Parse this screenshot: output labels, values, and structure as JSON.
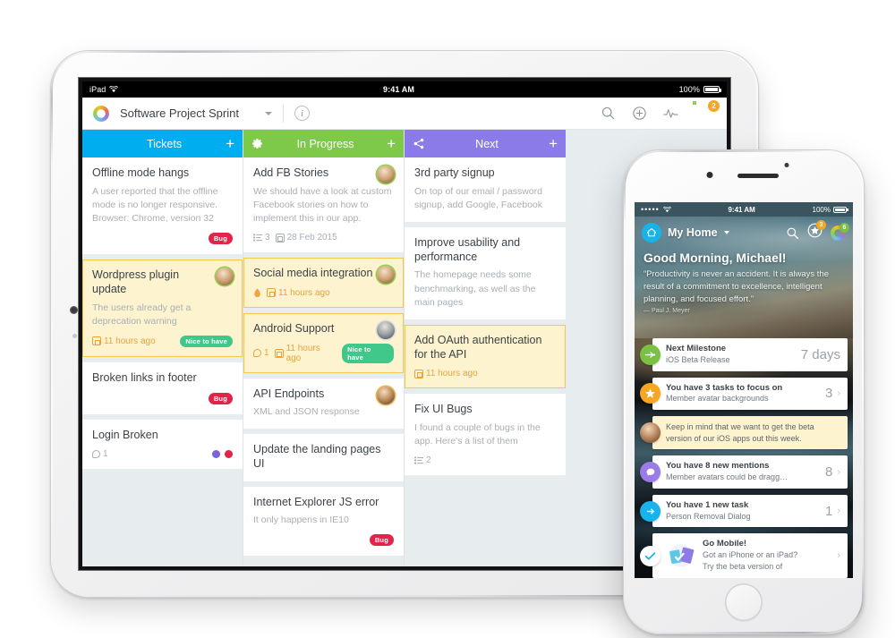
{
  "ipad": {
    "status_bar": {
      "device": "iPad",
      "wifi_icon": "wifi-icon",
      "time": "9:41 AM",
      "battery_pct": "100%"
    },
    "nav": {
      "logo_icon": "app-logo-icon",
      "project_title": "Software Project Sprint",
      "dropdown_icon": "chevron-down-icon",
      "info_icon": "info-icon",
      "search_icon": "search-icon",
      "add_icon": "plus-circle-icon",
      "activity_icon": "activity-pulse-icon",
      "avatar_icon": "user-avatar",
      "avatar_badge": "2"
    },
    "columns": [
      {
        "name": "Tickets",
        "color": "#00AEEF",
        "add_label": "+",
        "has_gear": false,
        "has_share": false,
        "cards": [
          {
            "title": "Offline mode hangs",
            "desc": "A user reported that the offline mode is no longer responsive. Browser: Chrome, version 32",
            "highlight": false,
            "avatar": null,
            "tag": "Bug",
            "tag_type": "bug",
            "meta": []
          },
          {
            "title": "Wordpress plugin update",
            "desc": "The users already get a deprecation warning",
            "highlight": true,
            "avatar": "av-a",
            "tag": "Nice to have",
            "tag_type": "nice",
            "meta": [
              {
                "icon": "calendar-icon",
                "text": "11 hours ago"
              }
            ]
          },
          {
            "title": "Broken links in footer",
            "desc": "",
            "highlight": false,
            "avatar": null,
            "tag": "Bug",
            "tag_type": "bug",
            "meta": []
          },
          {
            "title": "Login Broken",
            "desc": "",
            "highlight": false,
            "avatar": null,
            "tag": null,
            "tag_type": null,
            "meta": [
              {
                "icon": "comment-icon",
                "text": "1"
              }
            ],
            "dots": [
              "#7b61e0",
              "#e2244b"
            ]
          }
        ]
      },
      {
        "name": "In Progress",
        "color": "#7FC94A",
        "add_label": "+",
        "has_gear": true,
        "gear_icon": "gear-icon",
        "has_share": false,
        "cards": [
          {
            "title": "Add FB Stories",
            "desc": "We should have a look at custom Facebook stories on how to implement this in our app.",
            "highlight": false,
            "avatar": "av-a",
            "tag": null,
            "tag_type": null,
            "meta": [
              {
                "icon": "checklist-icon",
                "text": "3"
              },
              {
                "icon": "calendar-icon",
                "text": "28 Feb 2015"
              }
            ]
          },
          {
            "title": "Social media integration",
            "desc": "",
            "highlight": true,
            "avatar": "av-a",
            "tag": null,
            "tag_type": null,
            "meta": [
              {
                "icon": "flame-icon",
                "text": ""
              },
              {
                "icon": "calendar-icon",
                "text": "11 hours ago"
              }
            ]
          },
          {
            "title": "Android Support",
            "desc": "",
            "highlight": true,
            "avatar": "av-b",
            "tag": "Nice to have",
            "tag_type": "nice",
            "meta": [
              {
                "icon": "comment-icon",
                "text": "1"
              },
              {
                "icon": "calendar-icon",
                "text": "11 hours ago"
              }
            ]
          },
          {
            "title": "API Endpoints",
            "desc": "XML and JSON response",
            "highlight": false,
            "avatar": "av-c",
            "tag": null,
            "tag_type": null,
            "meta": []
          },
          {
            "title": "Update the landing pages UI",
            "desc": "",
            "highlight": false,
            "avatar": null,
            "tag": null,
            "tag_type": null,
            "meta": []
          },
          {
            "title": "Internet Explorer JS error",
            "desc": "It only happens in IE10",
            "highlight": false,
            "avatar": null,
            "tag": "Bug",
            "tag_type": "bug",
            "meta": []
          }
        ]
      },
      {
        "name": "Next",
        "color": "#8B7BE8",
        "add_label": "+",
        "has_gear": false,
        "has_share": true,
        "share_icon": "share-icon",
        "cards": [
          {
            "title": "3rd party signup",
            "desc": "On top of our email / password signup, add Google, Facebook",
            "highlight": false,
            "avatar": null,
            "tag": null,
            "tag_type": null,
            "meta": []
          },
          {
            "title": "Improve usability and performance",
            "desc": "The homepage needs some benchmarking, as well as the main pages",
            "highlight": false,
            "avatar": null,
            "tag": null,
            "tag_type": null,
            "meta": []
          },
          {
            "title": "Add OAuth authentication for the API",
            "desc": "",
            "highlight": true,
            "avatar": null,
            "tag": null,
            "tag_type": null,
            "meta": [
              {
                "icon": "calendar-icon",
                "text": "11 hours ago"
              }
            ]
          },
          {
            "title": "Fix UI Bugs",
            "desc": "I found a couple of bugs in the app. Here's a list of them",
            "highlight": false,
            "avatar": null,
            "tag": null,
            "tag_type": null,
            "meta": [
              {
                "icon": "checklist-icon",
                "text": "2"
              }
            ]
          }
        ]
      }
    ]
  },
  "iphone": {
    "status_bar": {
      "signal": "•••••",
      "wifi_icon": "wifi-icon",
      "time": "9:41 AM",
      "battery_pct": "100%"
    },
    "nav": {
      "home_icon": "home-icon",
      "title": "My Home",
      "dropdown_icon": "chevron-down-icon",
      "search_icon": "search-icon",
      "star_icon": "star-icon",
      "star_badge": "3",
      "logo_icon": "app-logo-icon",
      "logo_badge": "6"
    },
    "hero": {
      "greeting": "Good Morning, Michael!",
      "quote": "“Productivity is never an accident. It is always the result of a commitment to excellence, intelligent planning, and focused effort.”",
      "quote_author": "— Paul J. Meyer"
    },
    "feed": [
      {
        "type": "item",
        "icon": "milestone-arrow-icon",
        "icon_class": "fc-green",
        "title": "Next Milestone",
        "subtitle": "iOS Beta Release",
        "value": "7 days",
        "chevron": false
      },
      {
        "type": "item",
        "icon": "star-icon",
        "icon_class": "fc-orange",
        "title": "You have 3 tasks to focus on",
        "subtitle": "Member avatar backgrounds",
        "value": "3",
        "chevron": true
      },
      {
        "type": "note",
        "icon": "user-avatar",
        "icon_class": "fc-photo",
        "note": "Keep in mind that we want to get the beta version of our iOS apps out this week."
      },
      {
        "type": "item",
        "icon": "comment-icon",
        "icon_class": "fc-purple",
        "title": "You have 8 new mentions",
        "subtitle": "Member avatars could be dragg…",
        "value": "8",
        "chevron": true
      },
      {
        "type": "item",
        "icon": "arrow-right-icon",
        "icon_class": "fc-blue",
        "title": "You have 1 new task",
        "subtitle": "Person Removal Dialog",
        "value": "1",
        "chevron": true
      },
      {
        "type": "promo",
        "icon": "check-icon",
        "icon_class": "fc-white",
        "thumb_icon": "mobile-apps-icon",
        "title": "Go Mobile!",
        "subtitle": "Got an iPhone or an iPad?",
        "subtitle2": "Try the beta version of",
        "chevron": true
      }
    ]
  }
}
